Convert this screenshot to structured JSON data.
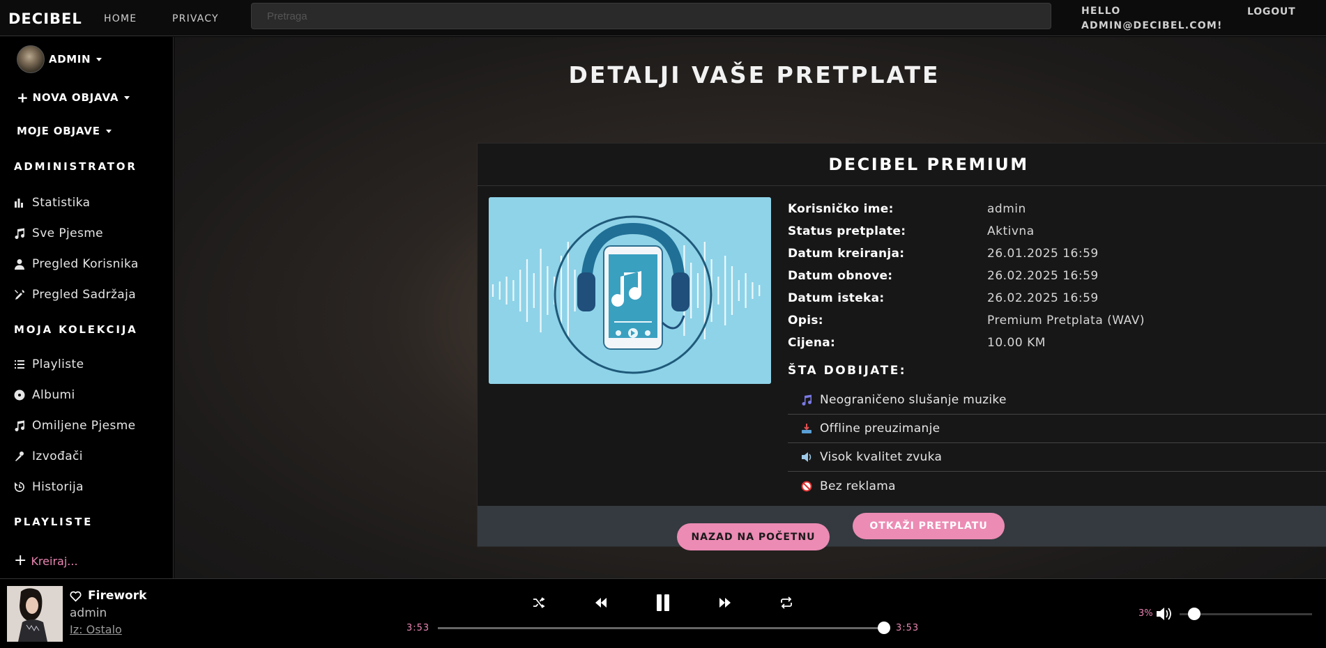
{
  "topbar": {
    "brand": "DECIBEL",
    "nav": {
      "home": "HOME",
      "privacy": "PRIVACY"
    },
    "search_placeholder": "Pretraga",
    "hello_line1": "HELLO",
    "hello_line2": "ADMIN@DECIBEL.COM!",
    "logout": "LOGOUT"
  },
  "sidebar": {
    "user": "ADMIN",
    "nova_objava": "NOVA OBJAVA",
    "moje_objave": "MOJE OBJAVE",
    "sections": {
      "admin": "ADMINISTRATOR",
      "kolekcija": "MOJA KOLEKCIJA",
      "playliste": "PLAYLISTE"
    },
    "admin_items": [
      {
        "label": "Statistika",
        "icon": "chart-icon"
      },
      {
        "label": "Sve Pjesme",
        "icon": "music-note-icon"
      },
      {
        "label": "Pregled Korisnika",
        "icon": "user-icon"
      },
      {
        "label": "Pregled Sadržaja",
        "icon": "tools-icon"
      }
    ],
    "kolekcija_items": [
      {
        "label": "Playliste",
        "icon": "list-icon"
      },
      {
        "label": "Albumi",
        "icon": "disc-icon"
      },
      {
        "label": "Omiljene Pjesme",
        "icon": "music-note-icon"
      },
      {
        "label": "Izvođači",
        "icon": "microphone-icon"
      },
      {
        "label": "Historija",
        "icon": "history-icon"
      }
    ],
    "kreiraj": "Kreiraj..."
  },
  "main": {
    "page_title": "DETALJI VAŠE PRETPLATE",
    "card_title": "DECIBEL PREMIUM",
    "details": [
      {
        "label": "Korisničko ime:",
        "value": "admin"
      },
      {
        "label": "Status pretplate:",
        "value": "Aktivna"
      },
      {
        "label": "Datum kreiranja:",
        "value": "26.01.2025 16:59"
      },
      {
        "label": "Datum obnove:",
        "value": "26.02.2025 16:59"
      },
      {
        "label": "Datum isteka:",
        "value": "26.02.2025 16:59"
      },
      {
        "label": "Opis:",
        "value": "Premium Pretplata (WAV)"
      },
      {
        "label": "Cijena:",
        "value": "10.00 KM"
      }
    ],
    "benefits_title": "ŠTA DOBIJATE:",
    "benefits": [
      {
        "label": "Neograničeno slušanje muzike",
        "icon": "music-notes-icon"
      },
      {
        "label": "Offline preuzimanje",
        "icon": "download-icon"
      },
      {
        "label": "Visok kvalitet zvuka",
        "icon": "speaker-icon"
      },
      {
        "label": "Bez reklama",
        "icon": "no-ads-icon"
      }
    ],
    "cancel_button": "OTKAŽI PRETPLATU",
    "back_button": "NAZAD NA POČETNU"
  },
  "player": {
    "title": "Firework",
    "artist": "admin",
    "album": "Iz: Ostalo",
    "time_current": "3:53",
    "time_total": "3:53",
    "progress": 1.0,
    "volume_label": "3%",
    "volume": 0.03,
    "accent": "#e986b2"
  },
  "colors": {
    "accent_pink": "#ec8bb4",
    "card_bg": "#171717",
    "footer_bg": "#343a40"
  }
}
